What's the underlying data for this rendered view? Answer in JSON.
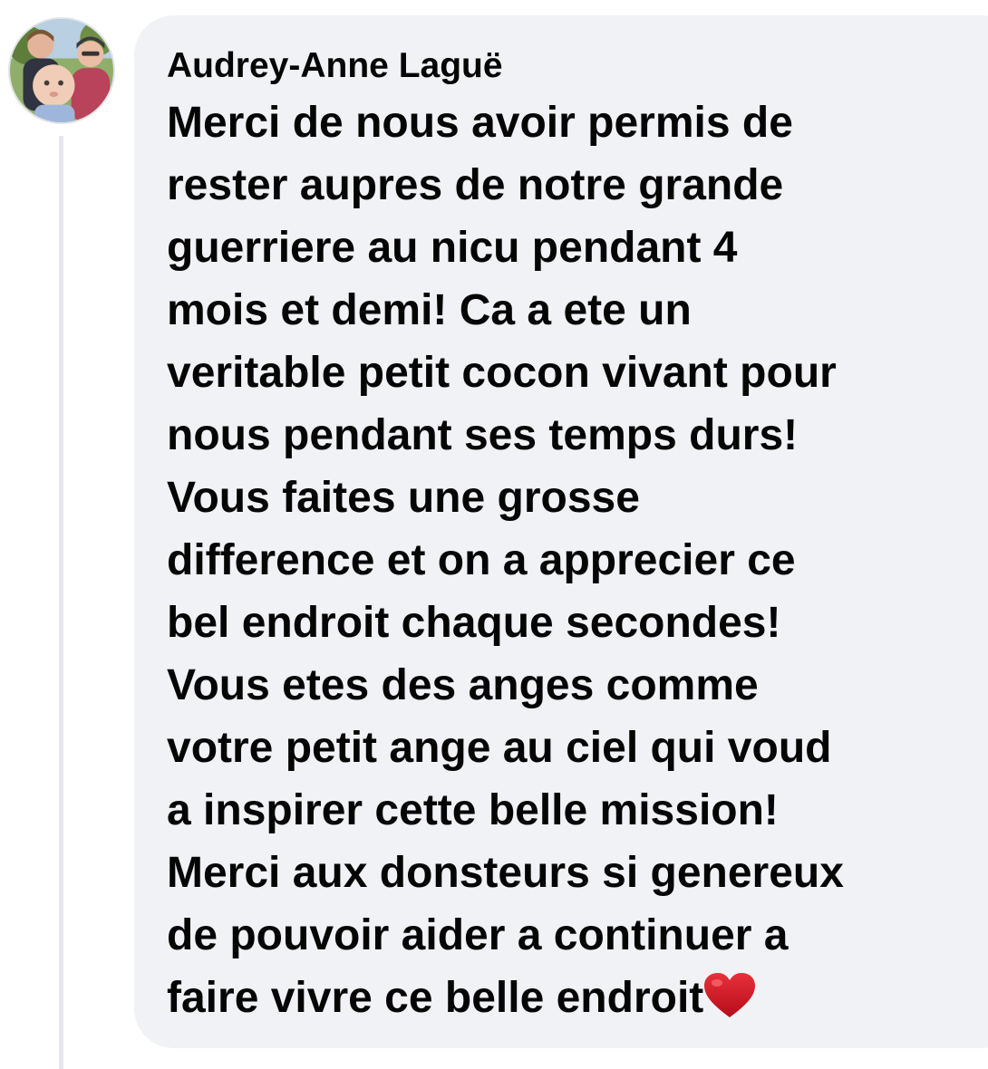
{
  "comment": {
    "author_name": "Audrey-Anne Laguë",
    "avatar_icon": "profile-photo",
    "lines": [
      "Merci de nous avoir permis de",
      "rester aupres de notre grande",
      "guerriere au nicu pendant 4",
      "mois et demi! Ca a ete un",
      "veritable petit cocon vivant pour",
      "nous pendant ses temps durs!",
      "Vous faites une grosse",
      "difference et on a apprecier ce",
      "bel endroit chaque secondes!",
      "Vous etes des anges comme",
      "votre petit ange au ciel qui voud",
      "a inspirer cette belle mission!",
      "Merci aux donsteurs si genereux",
      "de pouvoir aider a continuer a",
      "faire vivre ce belle endroit"
    ],
    "trailing_emoji": "red-heart-icon"
  },
  "colors": {
    "bubble_background": "#f0f2f5",
    "text": "#050505",
    "thread_line": "#e4e6eb",
    "heart": "#c8101f"
  }
}
